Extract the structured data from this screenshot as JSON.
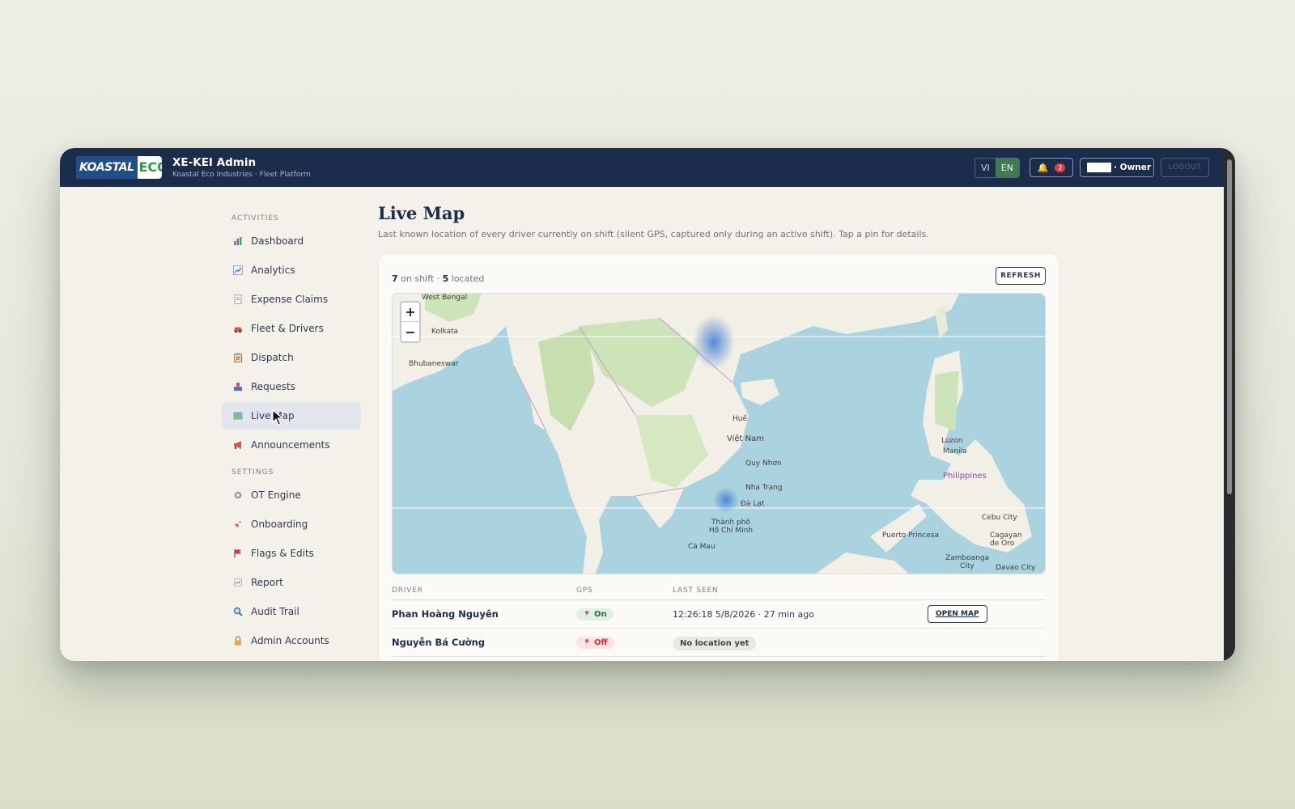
{
  "header": {
    "logo_left": "KOASTAL",
    "logo_right": "ECO",
    "title": "XE-KEI Admin",
    "subtitle": "Koastal Eco Industries · Fleet Platform",
    "lang_vi": "VI",
    "lang_en": "EN",
    "notifications_count": "2",
    "user_role": "· Owner",
    "logout_label": "LOGOUT"
  },
  "sidebar": {
    "activities_label": "ACTIVITIES",
    "activities": [
      {
        "label": "Dashboard",
        "icon": "bar-chart-icon"
      },
      {
        "label": "Analytics",
        "icon": "line-chart-icon"
      },
      {
        "label": "Expense Claims",
        "icon": "receipt-icon"
      },
      {
        "label": "Fleet & Drivers",
        "icon": "car-icon"
      },
      {
        "label": "Dispatch",
        "icon": "clipboard-icon"
      },
      {
        "label": "Requests",
        "icon": "inbox-icon"
      },
      {
        "label": "Live Map",
        "icon": "map-icon"
      },
      {
        "label": "Announcements",
        "icon": "megaphone-icon"
      }
    ],
    "settings_label": "SETTINGS",
    "settings": [
      {
        "label": "OT Engine",
        "icon": "gear-icon"
      },
      {
        "label": "Onboarding",
        "icon": "rocket-icon"
      },
      {
        "label": "Flags & Edits",
        "icon": "flag-icon"
      },
      {
        "label": "Report",
        "icon": "report-icon"
      },
      {
        "label": "Audit Trail",
        "icon": "magnifier-icon"
      },
      {
        "label": "Admin Accounts",
        "icon": "lock-icon"
      }
    ],
    "active_item": "Live Map"
  },
  "main": {
    "title": "Live Map",
    "description": "Last known location of every driver currently on shift (silent GPS, captured only during an active shift). Tap a pin for details.",
    "on_shift_count": "7",
    "on_shift_label": "on shift ·",
    "located_count": "5",
    "located_label": "located",
    "refresh_label": "REFRESH",
    "map": {
      "zoom_in": "+",
      "zoom_out": "−",
      "labels": [
        "West Bengal",
        "Kolkata",
        "Bhubaneswar",
        "Huế",
        "Việt Nam",
        "Quy Nhơn",
        "Nha Trang",
        "Đà Lạt",
        "Thành phố Hồ Chí Minh",
        "Cà Mau",
        "Luzon",
        "Manila",
        "Philippines",
        "Puerto Princesa",
        "Cebu City",
        "Cagayan de Oro",
        "Zamboanga City",
        "Davao City"
      ]
    },
    "table": {
      "columns": [
        "DRIVER",
        "GPS",
        "LAST SEEN"
      ],
      "rows": [
        {
          "driver": "Phan Hoàng Nguyên",
          "gps": "On",
          "last_seen": "12:26:18 5/8/2026 · 27 min ago",
          "action": "OPEN MAP"
        },
        {
          "driver": "Nguyễn Bá Cường",
          "gps": "Off",
          "last_seen": "No location yet",
          "action": ""
        }
      ]
    }
  },
  "colors": {
    "header_bg": "#1c2c4c",
    "accent_green": "#3f7a55",
    "badge_red": "#d2414a",
    "sea": "#aad3df"
  }
}
